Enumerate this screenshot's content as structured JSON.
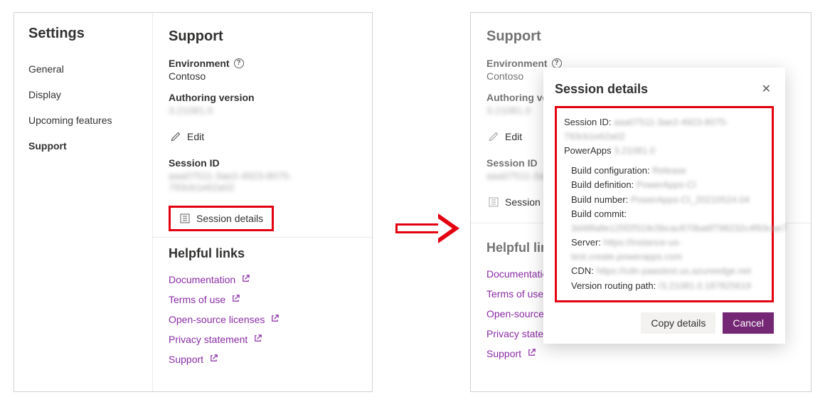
{
  "sidebar": {
    "title": "Settings",
    "items": [
      {
        "label": "General"
      },
      {
        "label": "Display"
      },
      {
        "label": "Upcoming features"
      },
      {
        "label": "Support"
      }
    ],
    "active_index": 3
  },
  "support": {
    "heading": "Support",
    "environment_label": "Environment",
    "environment_value": "Contoso",
    "authoring_label": "Authoring version",
    "authoring_value": "3.21081.0",
    "edit_label": "Edit",
    "session_id_label": "Session ID",
    "session_id_value": "aaa07511-3ae2-4923-8075-793cb1e62a02",
    "session_details_label": "Session details"
  },
  "helpful": {
    "heading": "Helpful links",
    "links": [
      {
        "label": "Documentation"
      },
      {
        "label": "Terms of use"
      },
      {
        "label": "Open-source licenses"
      },
      {
        "label": "Privacy statement"
      },
      {
        "label": "Support"
      }
    ]
  },
  "dialog": {
    "title": "Session details",
    "rows": {
      "session_id_k": "Session ID:",
      "session_id_v": "aaa07511-3ae2-4923-8075-793cb1e62a02",
      "powerapps_k": "PowerApps",
      "powerapps_v": "3.21081.0",
      "build_config_k": "Build configuration:",
      "build_config_v": "Release",
      "build_def_k": "Build definition:",
      "build_def_v": "PowerApps-CI",
      "build_num_k": "Build number:",
      "build_num_v": "PowerApps-CI_20210524.04",
      "build_commit_k": "Build commit:",
      "build_commit_v": "3d48fa8e125f2f319c5bcac870ba6f798232c4f93cae7",
      "server_k": "Server:",
      "server_v": "https://instance-us-test.create.powerapps.com",
      "cdn_k": "CDN:",
      "cdn_v": "https://cdn-paastest.us.azureedge.net",
      "routing_k": "Version routing path:",
      "routing_v": "/3.21081.0.187825619"
    },
    "copy_label": "Copy details",
    "cancel_label": "Cancel"
  }
}
